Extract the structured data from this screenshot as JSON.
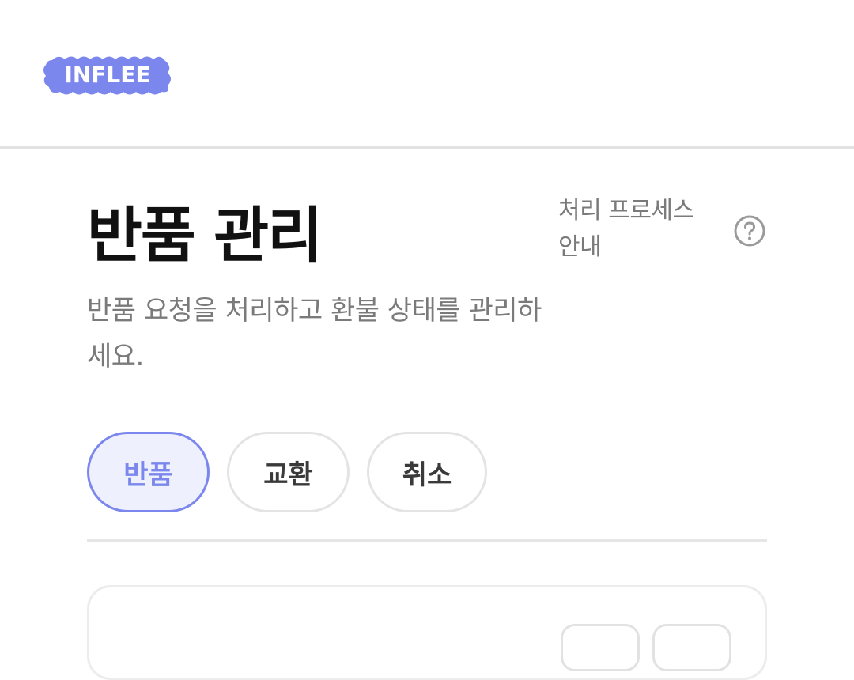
{
  "header": {
    "logo_text": "INFLEE",
    "brand_color": "#7b87ec"
  },
  "page": {
    "title": "반품 관리",
    "subtitle": "반품 요청을 처리하고 환불 상태를 관리하세요.",
    "process_link": "처리 프로세스 안내",
    "help_icon": "question-circle-icon"
  },
  "tabs": [
    {
      "label": "반품",
      "active": true
    },
    {
      "label": "교환",
      "active": false
    },
    {
      "label": "취소",
      "active": false
    }
  ],
  "colors": {
    "accent": "#7b87ec",
    "accent_bg": "#eef0fd",
    "muted_text": "#7a7a7a",
    "border": "#e4e4e4"
  }
}
